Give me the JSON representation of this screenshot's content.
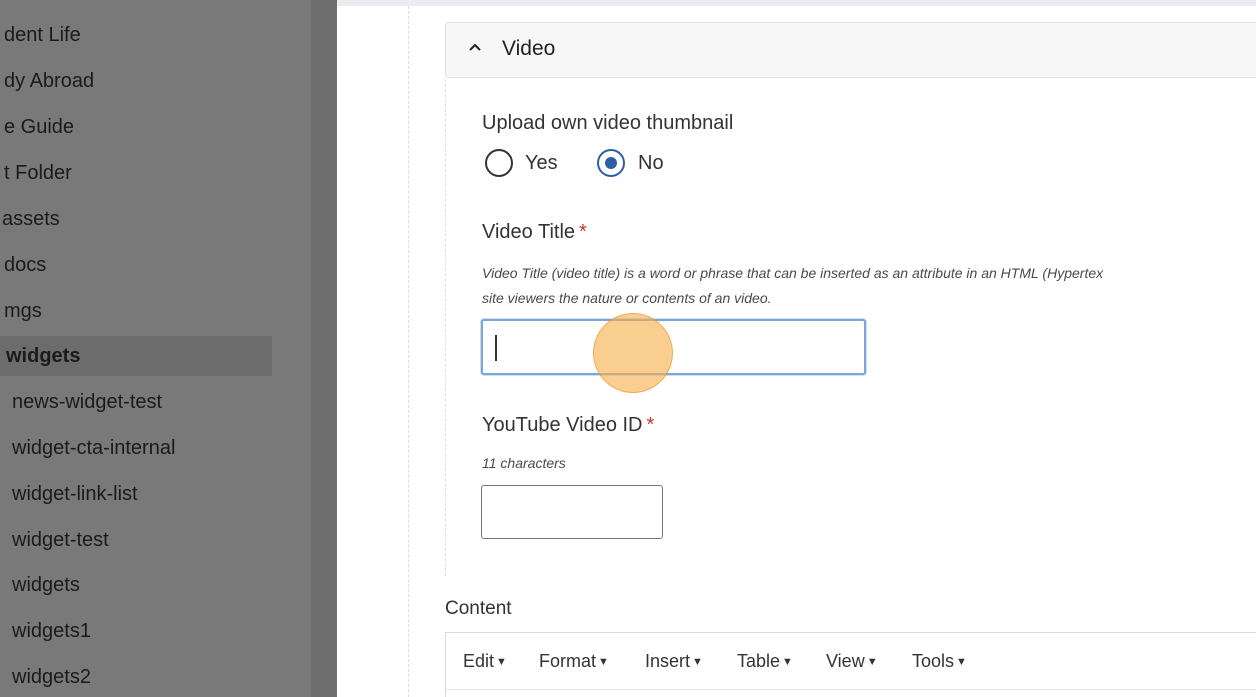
{
  "sidebar": {
    "items": [
      {
        "label": "dent Life"
      },
      {
        "label": "dy Abroad"
      },
      {
        "label": "e Guide"
      },
      {
        "label": "t Folder"
      },
      {
        "label": "assets"
      },
      {
        "label": "docs"
      },
      {
        "label": "mgs"
      },
      {
        "label": "widgets",
        "active": true
      },
      {
        "label": "news-widget-test"
      },
      {
        "label": "widget-cta-internal"
      },
      {
        "label": "widget-link-list"
      },
      {
        "label": "widget-test"
      },
      {
        "label": "widgets"
      },
      {
        "label": "widgets1"
      },
      {
        "label": "widgets2"
      }
    ]
  },
  "section": {
    "title": "Video",
    "chevron_icon": "chevron-up-icon"
  },
  "thumbnail": {
    "label": "Upload own video thumbnail",
    "options": [
      "Yes",
      "No"
    ],
    "selected": "No"
  },
  "video_title": {
    "label": "Video Title",
    "required": "*",
    "help_line1": "Video Title (video title) is a word or phrase that can be inserted as an attribute in an HTML (Hypertex",
    "help_line2": "site viewers the nature or contents of an video.",
    "value": ""
  },
  "youtube_id": {
    "label": "YouTube Video ID",
    "required": "*",
    "help": "11 characters",
    "value": ""
  },
  "content": {
    "label": "Content",
    "menu": [
      "Edit",
      "Format",
      "Insert",
      "Table",
      "View",
      "Tools"
    ]
  },
  "colors": {
    "accent": "#2e5fa3",
    "required": "#c0392b",
    "focus_border": "#7aa6d9",
    "click_indicator": "#f7b04a"
  }
}
